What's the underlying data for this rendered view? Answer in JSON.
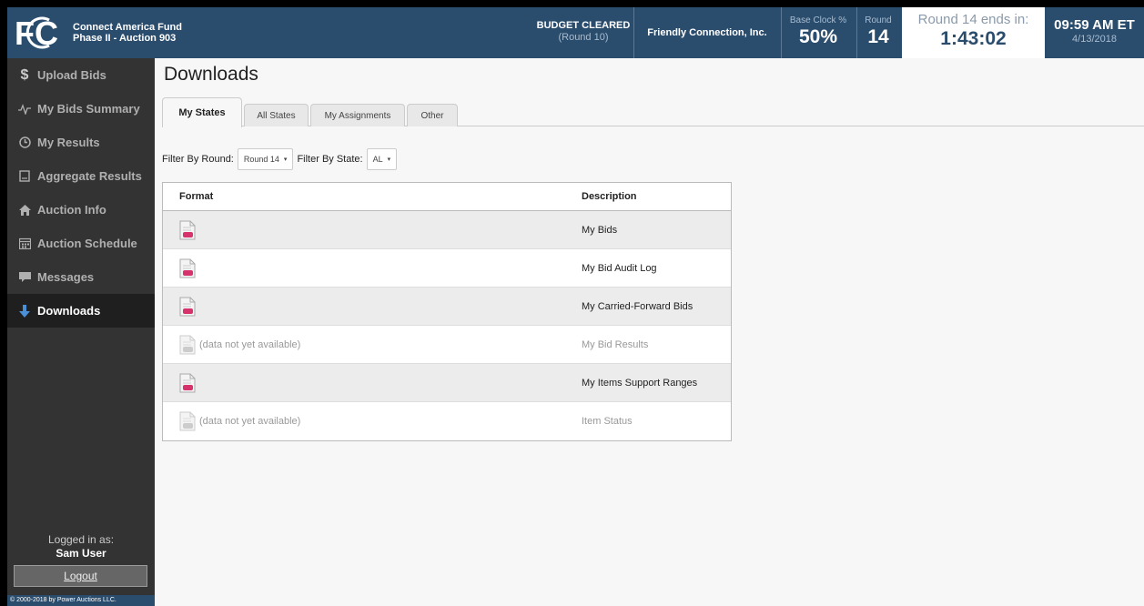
{
  "header": {
    "logo_text": "FC",
    "title_line1": "Connect America Fund",
    "title_line2": "Phase II - Auction 903",
    "budget_status": "BUDGET CLEARED",
    "budget_round": "(Round 10)",
    "company": "Friendly Connection, Inc.",
    "base_clock_label": "Base Clock %",
    "base_clock_value": "50%",
    "round_label": "Round",
    "round_value": "14",
    "countdown_label": "Round 14 ends in:",
    "countdown_value": "1:43:02",
    "time": "09:59 AM ET",
    "date": "4/13/2018"
  },
  "sidebar": {
    "items": [
      {
        "label": "Upload Bids",
        "icon": "dollar-icon"
      },
      {
        "label": "My Bids Summary",
        "icon": "pulse-icon"
      },
      {
        "label": "My Results",
        "icon": "clock-icon"
      },
      {
        "label": "Aggregate Results",
        "icon": "clipboard-icon"
      },
      {
        "label": "Auction Info",
        "icon": "home-icon"
      },
      {
        "label": "Auction Schedule",
        "icon": "calendar-icon"
      },
      {
        "label": "Messages",
        "icon": "chat-icon"
      },
      {
        "label": "Downloads",
        "icon": "download-arrow-icon",
        "active": true
      }
    ],
    "logged_in_label": "Logged in as:",
    "user_name": "Sam User",
    "logout_label": "Logout",
    "copyright": "© 2000-2018 by Power Auctions LLC."
  },
  "main": {
    "title": "Downloads",
    "tabs": [
      {
        "label": "My States",
        "active": true
      },
      {
        "label": "All States"
      },
      {
        "label": "My Assignments"
      },
      {
        "label": "Other"
      }
    ],
    "filter_round_label": "Filter By Round:",
    "filter_round_value": "Round 14",
    "filter_state_label": "Filter By State:",
    "filter_state_value": "AL",
    "table": {
      "headers": [
        "Format",
        "Description"
      ],
      "rows": [
        {
          "format": "",
          "description": "My Bids",
          "available": true
        },
        {
          "format": "",
          "description": "My Bid Audit Log",
          "available": true
        },
        {
          "format": "",
          "description": "My Carried-Forward Bids",
          "available": true
        },
        {
          "format": "(data not yet available)",
          "description": "My Bid Results",
          "available": false
        },
        {
          "format": "",
          "description": "My Items Support Ranges",
          "available": true
        },
        {
          "format": "(data not yet available)",
          "description": "Item Status",
          "available": false
        }
      ]
    }
  },
  "colors": {
    "header_bg": "#2b4d6d",
    "sidebar_bg": "#333333",
    "sidebar_active_bg": "#1f1f1f",
    "csv_icon_accent": "#d6336c",
    "download_arrow": "#4a90d9"
  }
}
